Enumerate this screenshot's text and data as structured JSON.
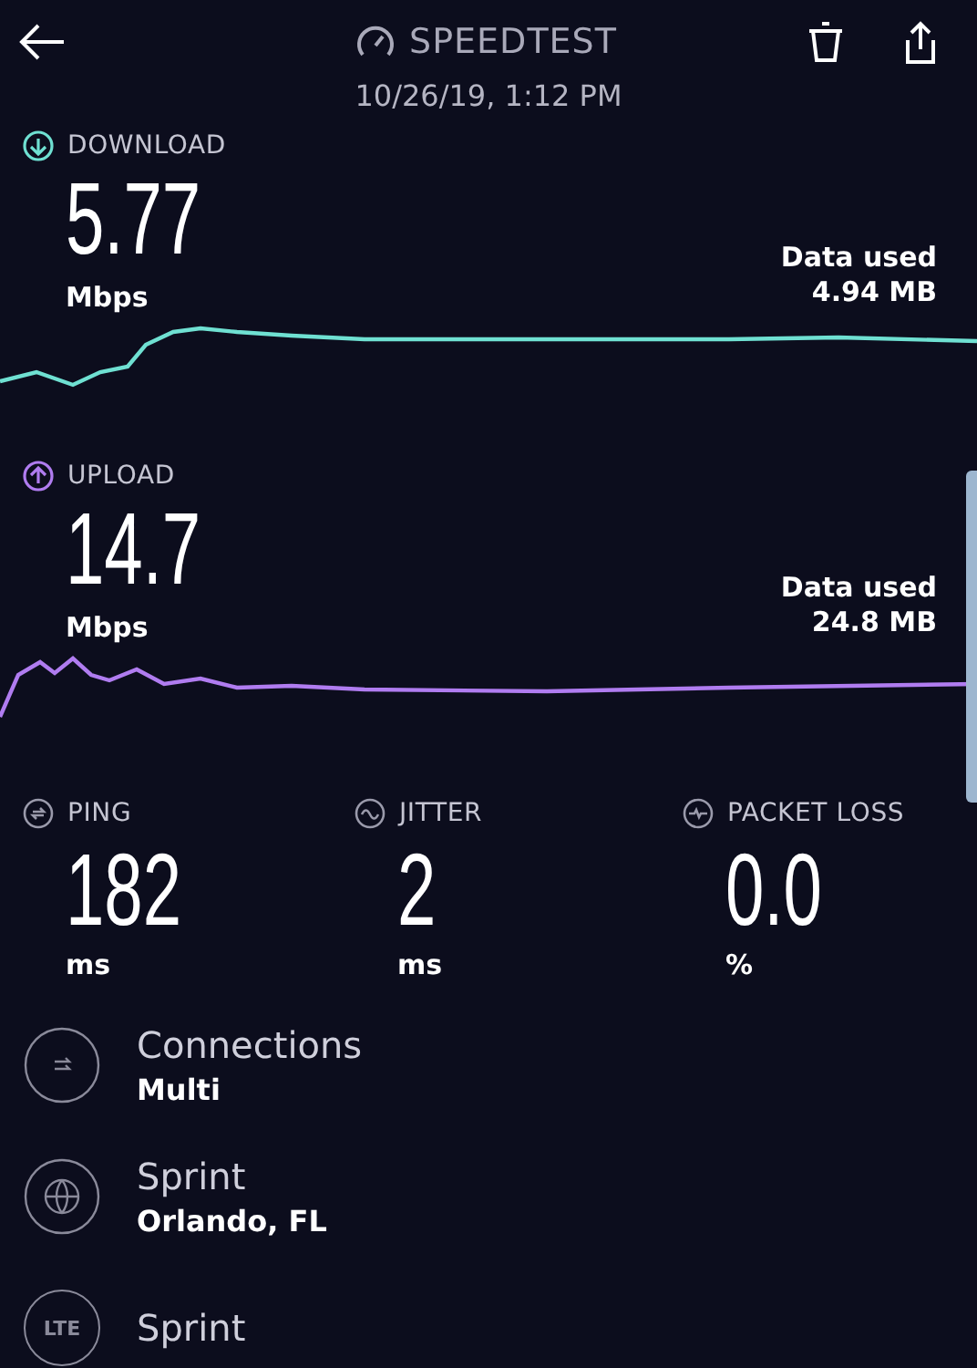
{
  "header": {
    "title": "SPEEDTEST",
    "date": "10/26/19, 1:12 PM"
  },
  "transfers": [
    {
      "kind": "download",
      "label": "DOWNLOAD",
      "value": "5.77",
      "unit": "Mbps",
      "data_label": "Data used",
      "data_value": "4.94 MB",
      "color": "#6fe0d2"
    },
    {
      "kind": "upload",
      "label": "UPLOAD",
      "value": "14.7",
      "unit": "Mbps",
      "data_label": "Data used",
      "data_value": "24.8 MB",
      "color": "#b07cf0"
    }
  ],
  "metrics": [
    {
      "kind": "ping",
      "label": "PING",
      "value": "182",
      "unit": "ms"
    },
    {
      "kind": "jitter",
      "label": "JITTER",
      "value": "2",
      "unit": "ms"
    },
    {
      "kind": "packet_loss",
      "label": "PACKET LOSS",
      "value": "0.0",
      "unit": "%"
    }
  ],
  "details": [
    {
      "kind": "connections",
      "title": "Connections",
      "subtitle": "Multi"
    },
    {
      "kind": "server",
      "title": "Sprint",
      "subtitle": "Orlando, FL"
    },
    {
      "kind": "network",
      "title": "Sprint",
      "icon_text": "LTE"
    }
  ]
}
